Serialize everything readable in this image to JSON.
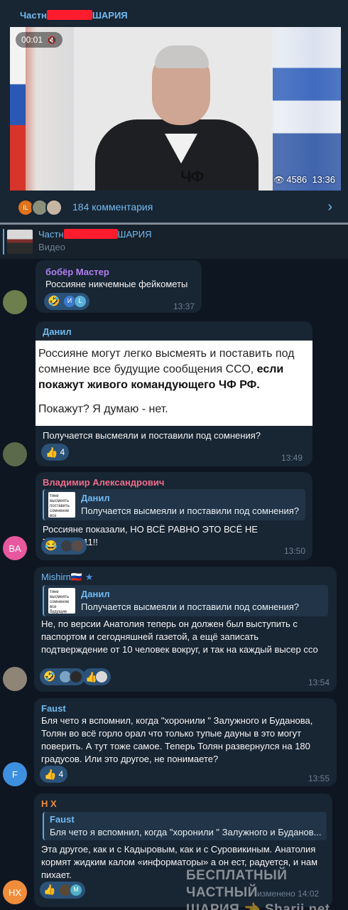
{
  "post": {
    "author_prefix": "Частн",
    "author_suffix": "ШАРИЯ",
    "video_time": "00:01",
    "mute_icon": "speaker-muted-icon",
    "video_watermark": "ЧФ",
    "views": "4586",
    "time": "13:36",
    "comment_avatars": [
      "IL",
      "",
      ""
    ],
    "comments_label": "184 комментария"
  },
  "reply_header": {
    "name_prefix": "Частн",
    "name_suffix": "ШАРИЯ",
    "sub": "Видео"
  },
  "messages": [
    {
      "name": "бобёр Мастер",
      "text": "Россияне никчемные фейкометы",
      "reactions": [
        "🤣",
        "И",
        "L"
      ],
      "time": "13:37"
    },
    {
      "name": "Данил",
      "screenshot_text_1": "Россияне могут легко высмеять и поставить под сомнение все будущие сообщения ССО, ",
      "screenshot_bold": "если покажут живого командующего ЧФ РФ.",
      "screenshot_text_2": "Покажут? Я думаю - нет.",
      "text": "Получается высмеяли и поставили под сомнения?",
      "reaction_emoji": "👍",
      "reaction_count": "4",
      "time": "13:49"
    },
    {
      "name": "Владимир Александрович",
      "quote_name": "Данил",
      "quote_text": "Получается высмеяли и поставили под сомнения?",
      "quote_thumb_text": "тяне высмеять поставить сомнение все будущие сообщения",
      "text": "Россияне показали, НО ВСЁ РАВНО ЭТО ВСЁ НЕ ТО!!!!!!!!!!!11!!",
      "avatar": "BA",
      "reactions": [
        "😂",
        "",
        ""
      ],
      "time": "13:50"
    },
    {
      "name": "Mishirn🇷🇺",
      "star_icon": "★",
      "quote_name": "Данил",
      "quote_text": "Получается высмеяли и поставили под сомнения?",
      "quote_thumb_text": "тяне высмеять сомнение все будущие командующего - нет.",
      "text": "Не, по версии Анатолия теперь он должен был выступить с паспортом и сегодняшней газетой, а ещё записать подтверждение от 10 человек вокруг, и так на каждый высер ссо",
      "reactions_a": [
        "🤣",
        "",
        ""
      ],
      "reactions_b": [
        "👍",
        ""
      ],
      "time": "13:54"
    },
    {
      "name": "Faust",
      "text": "Бля чето я вспомнил, когда \"хоронили \" Залужного и Буданова, Толян во всё горло орал что только тупые дауны в это могут поверить. А тут тоже самое. Теперь Толян развернулся на 180 градусов. Или это другое, не понимаете?",
      "avatar": "F",
      "reaction_emoji": "👍",
      "reaction_count": "4",
      "time": "13:55"
    },
    {
      "name": "H X",
      "quote_name": "Faust",
      "quote_text": "Бля чето я вспомнил, когда \"хоронили \" Залужного и Буданов...",
      "text": "Эта другое, как и с Кадыровым, как и с Суровикиным. Анатолия кормят жидким калом «информаторы» а он ест, радуется, и нам пихает.",
      "avatar": "HX",
      "reactions": [
        "👍",
        "",
        "M"
      ],
      "edited": "изменено 14:02"
    }
  ],
  "watermark": {
    "line1": "БЕСПЛАТНЫЙ ЧАСТНЫЙ",
    "line2": "ШАРИЯ 👈 Sharij.net"
  },
  "colors": {
    "background": "#0e1621",
    "bubble": "#182533",
    "accent": "#71baf0",
    "reaction": "#2b5278",
    "redaction": "#ff1c2c"
  }
}
